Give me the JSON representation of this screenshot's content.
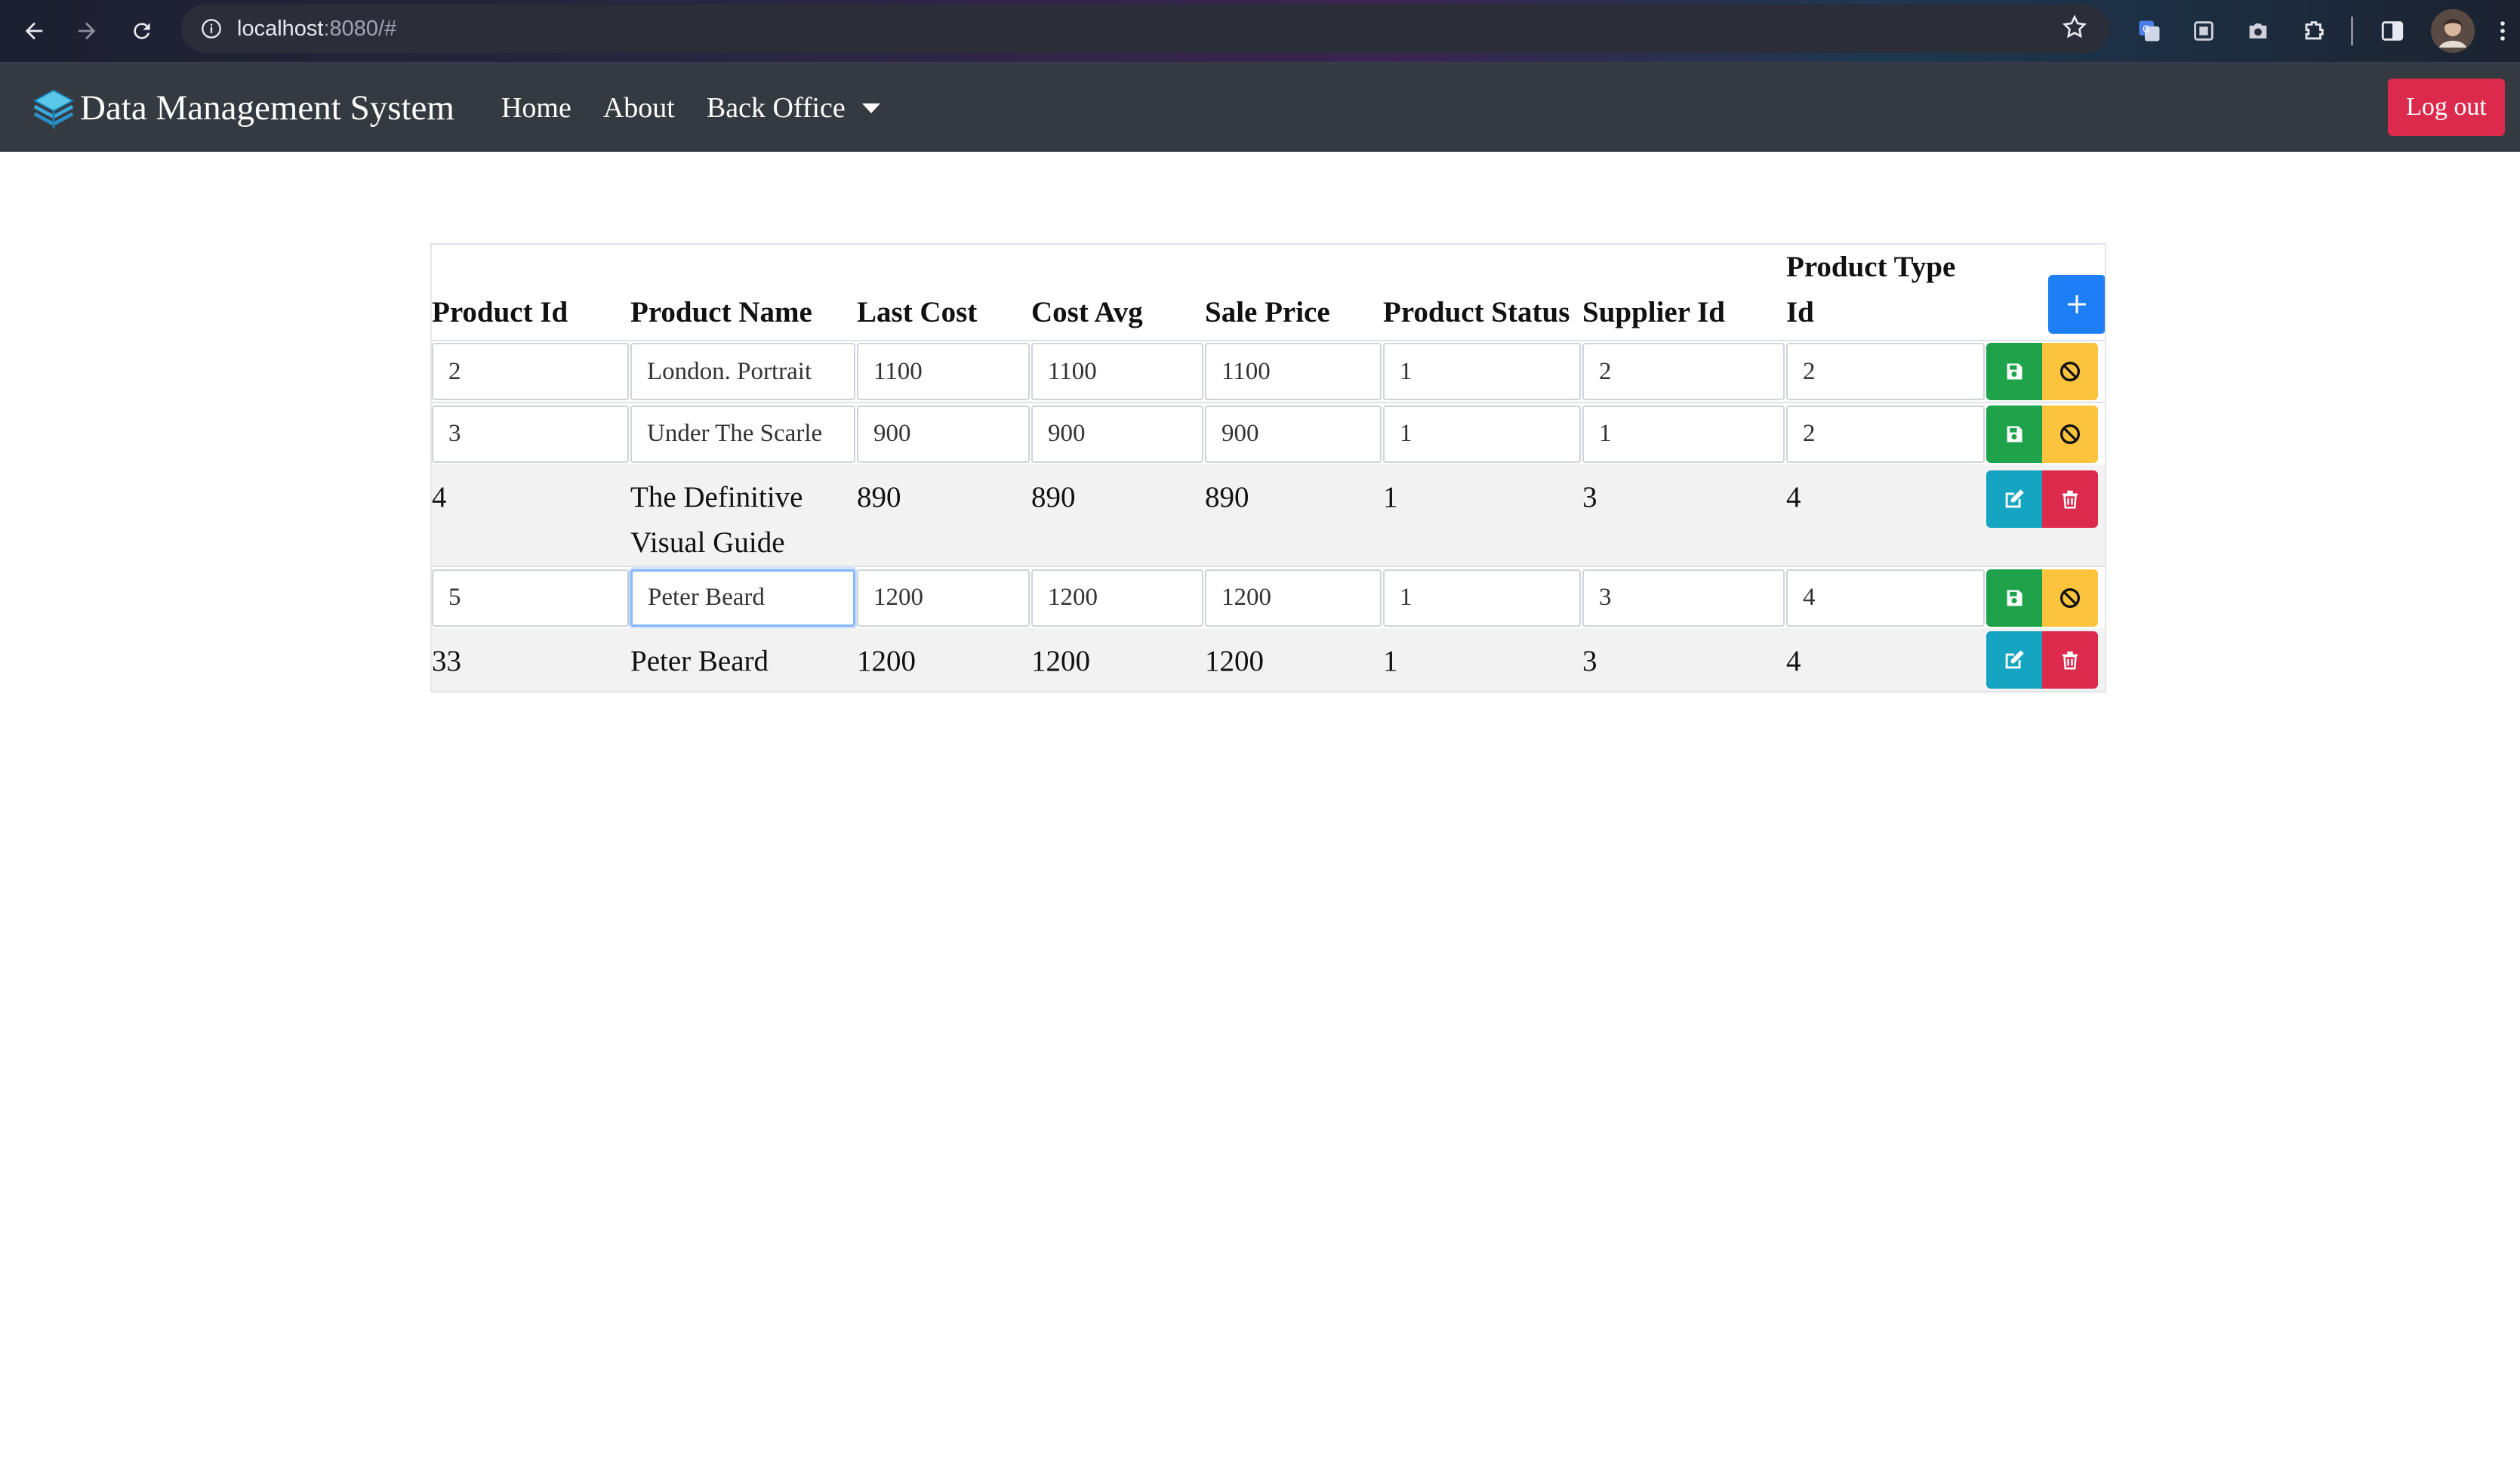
{
  "browser": {
    "url_host": "localhost",
    "url_rest": ":8080/#"
  },
  "navbar": {
    "brand": "Data Management System",
    "links": [
      "Home",
      "About",
      "Back Office"
    ],
    "logout": "Log out"
  },
  "table": {
    "headers": [
      "Product Id",
      "Product Name",
      "Last Cost",
      "Cost Avg",
      "Sale Price",
      "Product Status",
      "Supplier Id",
      "Product Type Id"
    ],
    "rows": [
      {
        "mode": "edit",
        "cells": [
          "2",
          "London. Portrait",
          "1100",
          "1100",
          "1100",
          "1",
          "2",
          "2"
        ]
      },
      {
        "mode": "edit",
        "cells": [
          "3",
          "Under The Scarle",
          "900",
          "900",
          "900",
          "1",
          "1",
          "2"
        ]
      },
      {
        "mode": "view",
        "cells": [
          "4",
          "The Definitive Visual Guide",
          "890",
          "890",
          "890",
          "1",
          "3",
          "4"
        ]
      },
      {
        "mode": "edit",
        "cells": [
          "5",
          "Peter Beard",
          "1200",
          "1200",
          "1200",
          "1",
          "3",
          "4"
        ]
      },
      {
        "mode": "view",
        "cells": [
          "33",
          "Peter Beard",
          "1200",
          "1200",
          "1200",
          "1",
          "3",
          "4"
        ]
      }
    ]
  },
  "colors": {
    "navbar_bg": "#343a40",
    "save": "#1ea34a",
    "cancel": "#fcc43c",
    "edit": "#16a4c3",
    "delete": "#dc2a4d",
    "add": "#1e7ef5"
  },
  "icons": [
    "back-arrow-icon",
    "forward-arrow-icon",
    "reload-icon",
    "info-icon",
    "star-icon",
    "layers-logo-icon",
    "plus-icon",
    "save-icon",
    "cancel-icon",
    "edit-icon",
    "trash-icon"
  ]
}
